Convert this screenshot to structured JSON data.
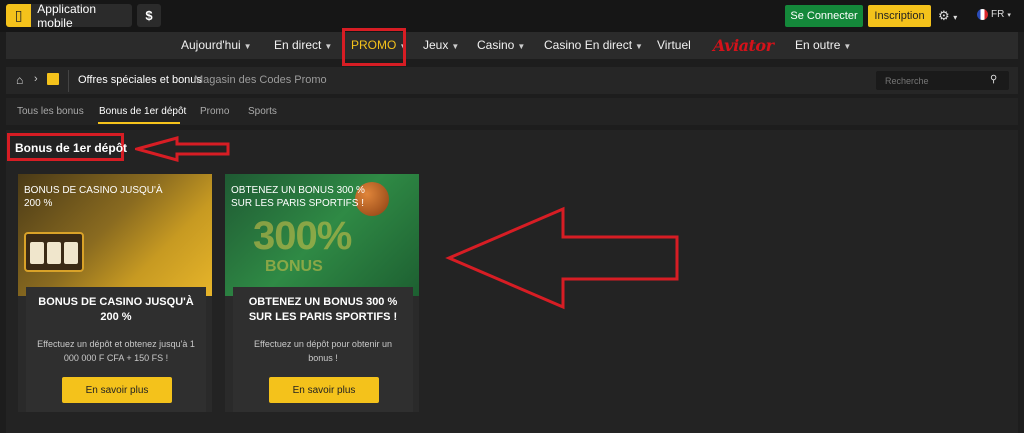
{
  "topbar": {
    "app_label": "Application mobile",
    "dollar": "$",
    "login": "Se Connecter",
    "signup": "Inscription",
    "lang": "FR"
  },
  "nav": {
    "items": [
      {
        "label": "Aujourd'hui"
      },
      {
        "label": "En direct"
      },
      {
        "label": "PROMO"
      },
      {
        "label": "Jeux"
      },
      {
        "label": "Casino"
      },
      {
        "label": "Casino En direct"
      },
      {
        "label": "Virtuel"
      },
      {
        "label": "Aviator"
      },
      {
        "label": "En outre"
      }
    ]
  },
  "breadcrumb": {
    "active": "Offres spéciales et bonus",
    "other": "Magasin des Codes Promo",
    "search_placeholder": "Recherche"
  },
  "tabs": [
    "Tous les bonus",
    "Bonus de 1er dépôt",
    "Promo",
    "Sports"
  ],
  "section_title": "Bonus de 1er dépôt",
  "cards": [
    {
      "banner": "BONUS DE CASINO JUSQU'À 200 %",
      "title": "BONUS DE CASINO JUSQU'À 200 %",
      "desc": "Effectuez un dépôt et obtenez jusqu'à 1 000 000 F CFA + 150 FS !",
      "button": "En savoir plus"
    },
    {
      "banner": "OBTENEZ UN BONUS 300 % SUR LES PARIS SPORTIFS !",
      "banner_big": "300%",
      "banner_small": "BONUS",
      "title": "OBTENEZ UN BONUS 300 % SUR LES PARIS SPORTIFS !",
      "desc": "Effectuez un dépôt pour obtenir un bonus !",
      "button": "En savoir plus"
    }
  ]
}
